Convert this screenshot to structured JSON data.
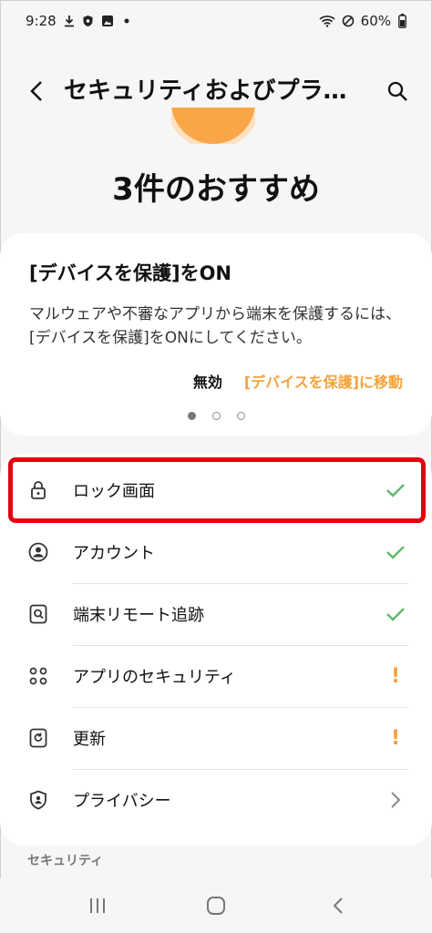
{
  "status_bar": {
    "time": "9:28",
    "battery": "60%",
    "icons_left": [
      "download-icon",
      "shield-icon",
      "image-icon",
      "dot-icon"
    ],
    "icons_right": [
      "wifi-icon",
      "dnd-icon",
      "battery-icon"
    ]
  },
  "header": {
    "title": "セキュリティおよびプラ…"
  },
  "recommendations": {
    "heading": "3件のおすすめ",
    "card": {
      "title": "[デバイスを保護]をON",
      "description": "マルウェアや不審なアプリから端末を保護するには、[デバイスを保護]をONにしてください。",
      "disable_label": "無効",
      "goto_label": "[デバイスを保護]に移動"
    },
    "page_count": 3,
    "active_page": 1
  },
  "items": [
    {
      "label": "ロック画面",
      "icon": "lock-icon",
      "status": "check"
    },
    {
      "label": "アカウント",
      "icon": "account-icon",
      "status": "check"
    },
    {
      "label": "端末リモート追跡",
      "icon": "find-device-icon",
      "status": "check"
    },
    {
      "label": "アプリのセキュリティ",
      "icon": "apps-icon",
      "status": "warning"
    },
    {
      "label": "更新",
      "icon": "update-icon",
      "status": "warning"
    },
    {
      "label": "プライバシー",
      "icon": "privacy-shield-icon",
      "status": "chevron"
    }
  ],
  "status_marks": {
    "warning": "!"
  },
  "section_label": "セキュリティ",
  "colors": {
    "accent_orange": "#f4a23c",
    "check_green": "#5fba6c",
    "highlight_red": "#e3000f"
  }
}
